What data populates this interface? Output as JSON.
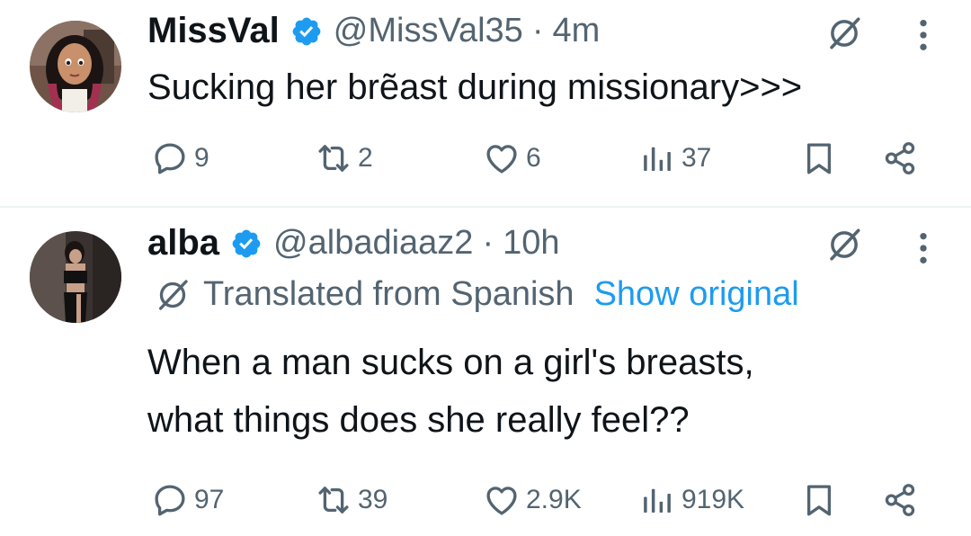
{
  "tweets": [
    {
      "name": "MissVal",
      "handle": "@MissVal35",
      "separator": "·",
      "time": "4m",
      "text": "Sucking her brẽast during missionary>>>",
      "replies": "9",
      "reposts": "2",
      "likes": "6",
      "views": "37"
    },
    {
      "name": "alba",
      "handle": "@albadiaaz2",
      "separator": "·",
      "time": "10h",
      "translated_label": "Translated from Spanish",
      "show_original": "Show original",
      "text_line1": "When a man sucks on a girl's breasts,",
      "text_line2": "what things does she really feel??",
      "replies": "97",
      "reposts": "39",
      "likes": "2.9K",
      "views": "919K"
    }
  ],
  "colors": {
    "text": "#0f1419",
    "secondary": "#536471",
    "accent": "#1d9bf0",
    "divider": "#eff3f4"
  },
  "icons": [
    "verified-badge-icon",
    "grok-icon",
    "more-icon",
    "reply-icon",
    "repost-icon",
    "like-icon",
    "views-icon",
    "bookmark-icon",
    "share-icon",
    "translate-icon"
  ]
}
